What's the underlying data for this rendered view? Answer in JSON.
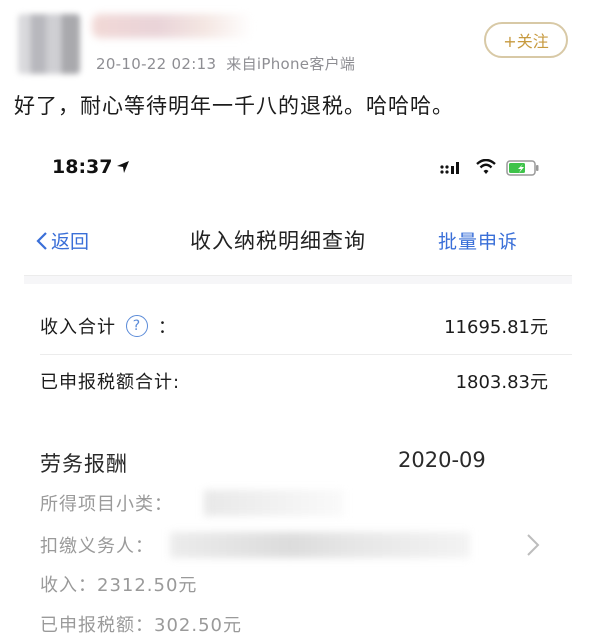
{
  "post": {
    "meta_time": "20-10-22 02:13",
    "meta_source": "来自iPhone客户端",
    "follow_label": "+关注",
    "text": "好了，耐心等待明年一千八的退税。哈哈哈。"
  },
  "screenshot": {
    "status_time": "18:37",
    "nav": {
      "back_label": "返回",
      "title": "收入纳税明细查询",
      "right_label": "批量申诉"
    },
    "summary": {
      "income_label": "收入合计",
      "help_symbol": "?",
      "colon": "：",
      "income_value": "11695.81元",
      "tax_label": "已申报税额合计:",
      "tax_value": "1803.83元"
    },
    "record": {
      "title": "劳务报酬",
      "date": "2020-09",
      "category_label": "所得项目小类：",
      "withholder_label": "扣缴义务人：",
      "income_line": "收入：2312.50元",
      "tax_line": "已申报税额：302.50元"
    }
  },
  "colors": {
    "link_blue": "#3a6fd8",
    "follow_gold": "#c79a3f",
    "meta_gray": "#8e8e93"
  }
}
